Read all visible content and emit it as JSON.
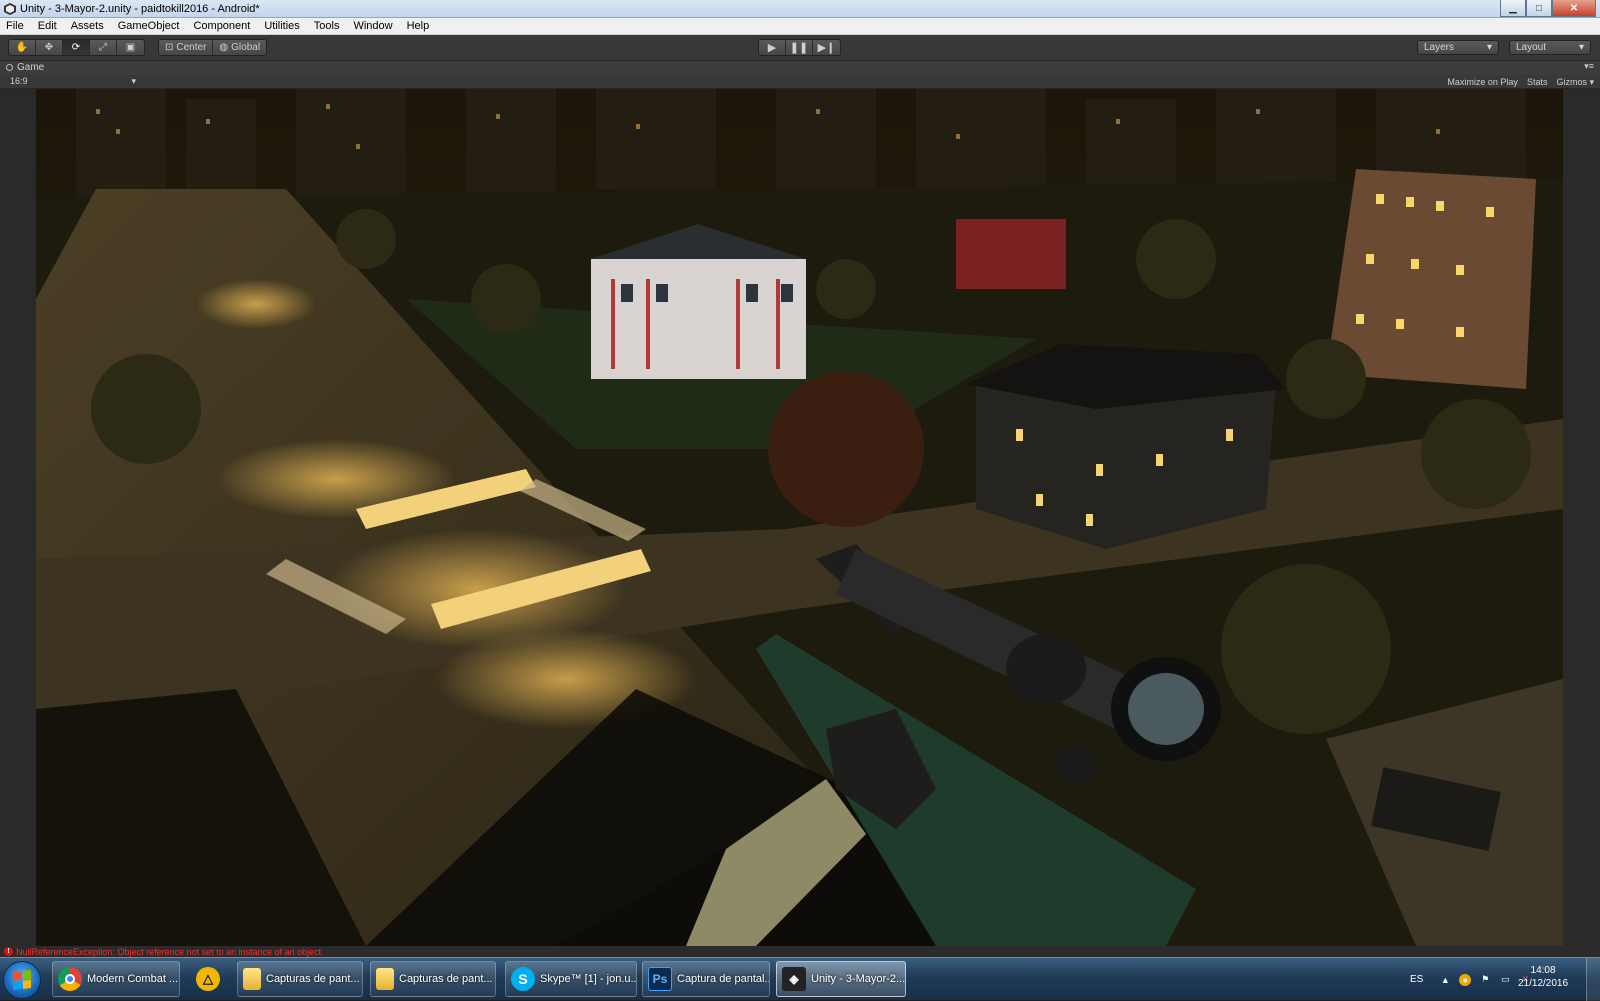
{
  "window": {
    "title": "Unity - 3-Mayor-2.unity - paidtokill2016 - Android*"
  },
  "menu": [
    "File",
    "Edit",
    "Assets",
    "GameObject",
    "Component",
    "Utilities",
    "Tools",
    "Window",
    "Help"
  ],
  "toolbar": {
    "tools": [
      "hand-tool",
      "move-tool",
      "rotate-tool",
      "scale-tool",
      "rect-tool"
    ],
    "pivot_label": "Center",
    "space_label": "Global",
    "layers_label": "Layers",
    "layout_label": "Layout"
  },
  "game_view": {
    "tab_label": "Game",
    "aspect": "16:9",
    "maximize_label": "Maximize on Play",
    "stats_label": "Stats",
    "gizmos_label": "Gizmos"
  },
  "console": {
    "error": "NullReferenceException: Object reference not set to an instance of an object"
  },
  "taskbar": {
    "items": [
      {
        "label": "Modern Combat ...",
        "icon": "chrome-icon"
      },
      {
        "label": "Capturas de pant...",
        "icon": "folder-icon"
      },
      {
        "label": "Capturas de pant...",
        "icon": "folder-icon"
      },
      {
        "label": "Skype™ [1] - jon.u...",
        "icon": "skype-icon"
      },
      {
        "label": "Captura de pantal...",
        "icon": "photoshop-icon"
      },
      {
        "label": "Unity - 3-Mayor-2...",
        "icon": "unity-icon"
      }
    ],
    "language": "ES",
    "time": "14:08",
    "date": "21/12/2016"
  }
}
